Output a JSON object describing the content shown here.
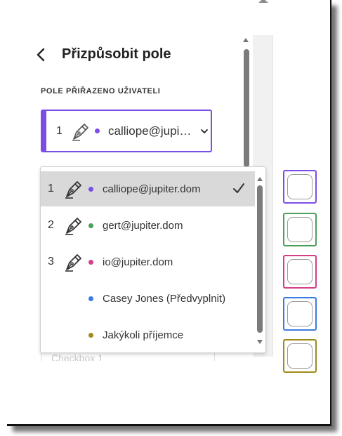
{
  "header": {
    "title": "Přizpůsobit pole",
    "back_icon": "chevron-left-icon"
  },
  "assigned": {
    "section_label": "POLE PŘIŘAZENO UŽIVATELI",
    "current": {
      "number": "1",
      "icon": "pen-nib-icon",
      "dot_color": "#7a4ee6",
      "email": "calliope@jupiter.dom",
      "email_display": "calliope@jupi…"
    }
  },
  "dropdown": {
    "options": [
      {
        "number": "1",
        "icon": "pen-nib-icon",
        "dot_color": "#7a4ee6",
        "label": "calliope@jupiter.dom",
        "selected": true
      },
      {
        "number": "2",
        "icon": "pen-nib-icon",
        "dot_color": "#4a9f5a",
        "label": "gert@jupiter.dom",
        "selected": false
      },
      {
        "number": "3",
        "icon": "pen-nib-icon",
        "dot_color": "#d63c8a",
        "label": "io@jupiter.dom",
        "selected": false
      },
      {
        "number": "",
        "icon": "",
        "dot_color": "#3a7be0",
        "label": "Casey Jones (Předvyplnit)",
        "selected": false
      },
      {
        "number": "",
        "icon": "",
        "dot_color": "#a08a18",
        "label": "Jakýkoli příjemce",
        "selected": false
      }
    ]
  },
  "ghost_field_text": "Checkbox 1",
  "document_fields": [
    {
      "name": "field-calliope",
      "color": "#7a4ee6"
    },
    {
      "name": "field-gert",
      "color": "#4a9f5a"
    },
    {
      "name": "field-io",
      "color": "#d63c8a"
    },
    {
      "name": "field-casey",
      "color": "#3a7be0"
    },
    {
      "name": "field-anyone",
      "color": "#a08a18"
    }
  ]
}
